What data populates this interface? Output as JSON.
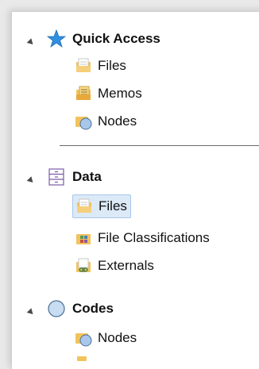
{
  "navigation": {
    "groups": [
      {
        "label": "Quick Access",
        "icon": "star-icon",
        "items": [
          {
            "label": "Files",
            "icon": "files-folder-icon"
          },
          {
            "label": "Memos",
            "icon": "memos-folder-icon"
          },
          {
            "label": "Nodes",
            "icon": "nodes-folder-icon"
          }
        ]
      },
      {
        "label": "Data",
        "icon": "data-cabinet-icon",
        "items": [
          {
            "label": "Files",
            "icon": "files-folder-icon",
            "selected": true
          },
          {
            "label": "File Classifications",
            "icon": "file-classifications-icon"
          },
          {
            "label": "Externals",
            "icon": "externals-folder-icon"
          }
        ]
      },
      {
        "label": "Codes",
        "icon": "codes-circle-icon",
        "items": [
          {
            "label": "Nodes",
            "icon": "nodes-folder-icon"
          }
        ]
      }
    ]
  },
  "colors": {
    "star": "#2f8fe0",
    "folder": "#f2c35c",
    "circle": "#a9c7ea",
    "selection": "#dce9f7"
  }
}
